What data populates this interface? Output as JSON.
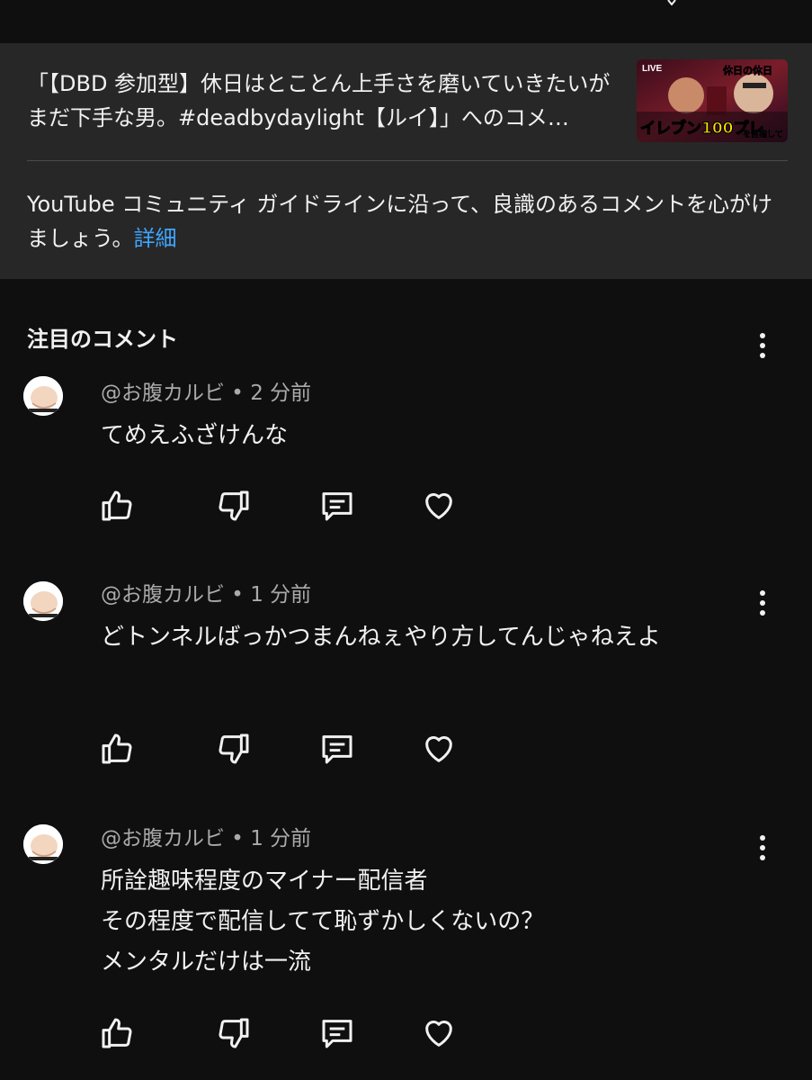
{
  "video": {
    "title": "「【DBD 参加型】休日はとことん上手さを磨いていきたいがまだ下手な男。#deadbydaylight【ルイ】」へのコメ…",
    "thumbnail_text": {
      "live": "LIVE",
      "top": "休日の休日",
      "main": "イレブン100プレ",
      "side": "を目指して"
    }
  },
  "guideline": {
    "text": "YouTube コミュニティ ガイドラインに沿って、良識のあるコメントを心がけましょう。",
    "link": "詳細"
  },
  "section": {
    "title": "注目のコメント"
  },
  "comments": [
    {
      "meta": "@お腹カルビ • 2 分前",
      "lines": [
        "てめえふざけんな"
      ]
    },
    {
      "meta": "@お腹カルビ • 1 分前",
      "lines": [
        "どトンネルばっかつまんねぇやり方してんじゃねえよ"
      ]
    },
    {
      "meta": "@お腹カルビ • 1 分前",
      "lines": [
        "所詮趣味程度のマイナー配信者",
        "その程度で配信してて恥ずかしくないの？",
        "メンタルだけは一流"
      ]
    }
  ],
  "icons": {
    "like": "thumbs-up-icon",
    "dislike": "thumbs-down-icon",
    "reply": "reply-icon",
    "heart": "heart-icon",
    "more": "more-vertical-icon"
  },
  "colors": {
    "background": "#0f0f0f",
    "card": "#272727",
    "link": "#3ea6ff",
    "meta": "#aaaaaa",
    "text": "#f1f1f1"
  }
}
